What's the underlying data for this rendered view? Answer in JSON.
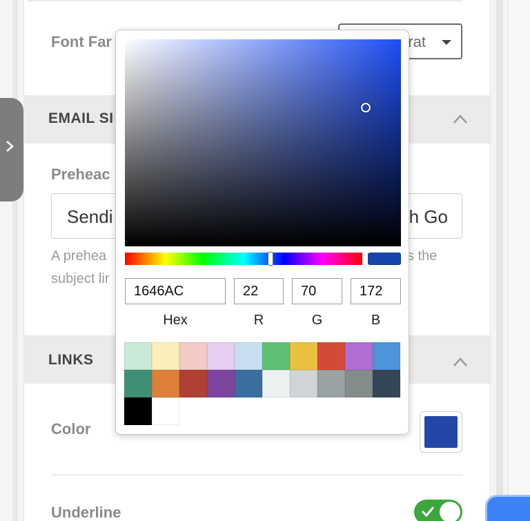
{
  "settings": {
    "font_family_label": "Font Far",
    "font_family_value": "rrat",
    "email_section_title": "EMAIL SI",
    "preheader_label": "Preheac",
    "preheader_value_start": "Sendi",
    "preheader_value_end": "h Go",
    "help_line1_start": "A prehea",
    "help_line1_end": "s the",
    "help_line2_start": "subject lir",
    "links_section_title": "LINKS",
    "color_label": "Color",
    "link_color": "#2446a8",
    "underline_label": "Underline",
    "underline_enabled": true
  },
  "picker": {
    "hex_value": "1646AC",
    "r_value": "22",
    "g_value": "70",
    "b_value": "172",
    "hex_label": "Hex",
    "r_label": "R",
    "g_label": "G",
    "b_label": "B",
    "preview_color": "#1646AC",
    "swatches": [
      "#c8ead6",
      "#fbeebc",
      "#f3cac6",
      "#e6cdf2",
      "#c8dff1",
      "#5fbf73",
      "#e9c13e",
      "#d44a3a",
      "#b06ed4",
      "#4f93d8",
      "#3f8f77",
      "#dd7f3b",
      "#b04032",
      "#7d45a0",
      "#3a6e9f",
      "#ecf0f1",
      "#d0d4d6",
      "#99a3a4",
      "#838b8b",
      "#354657",
      "#000000",
      "#ffffff"
    ]
  }
}
